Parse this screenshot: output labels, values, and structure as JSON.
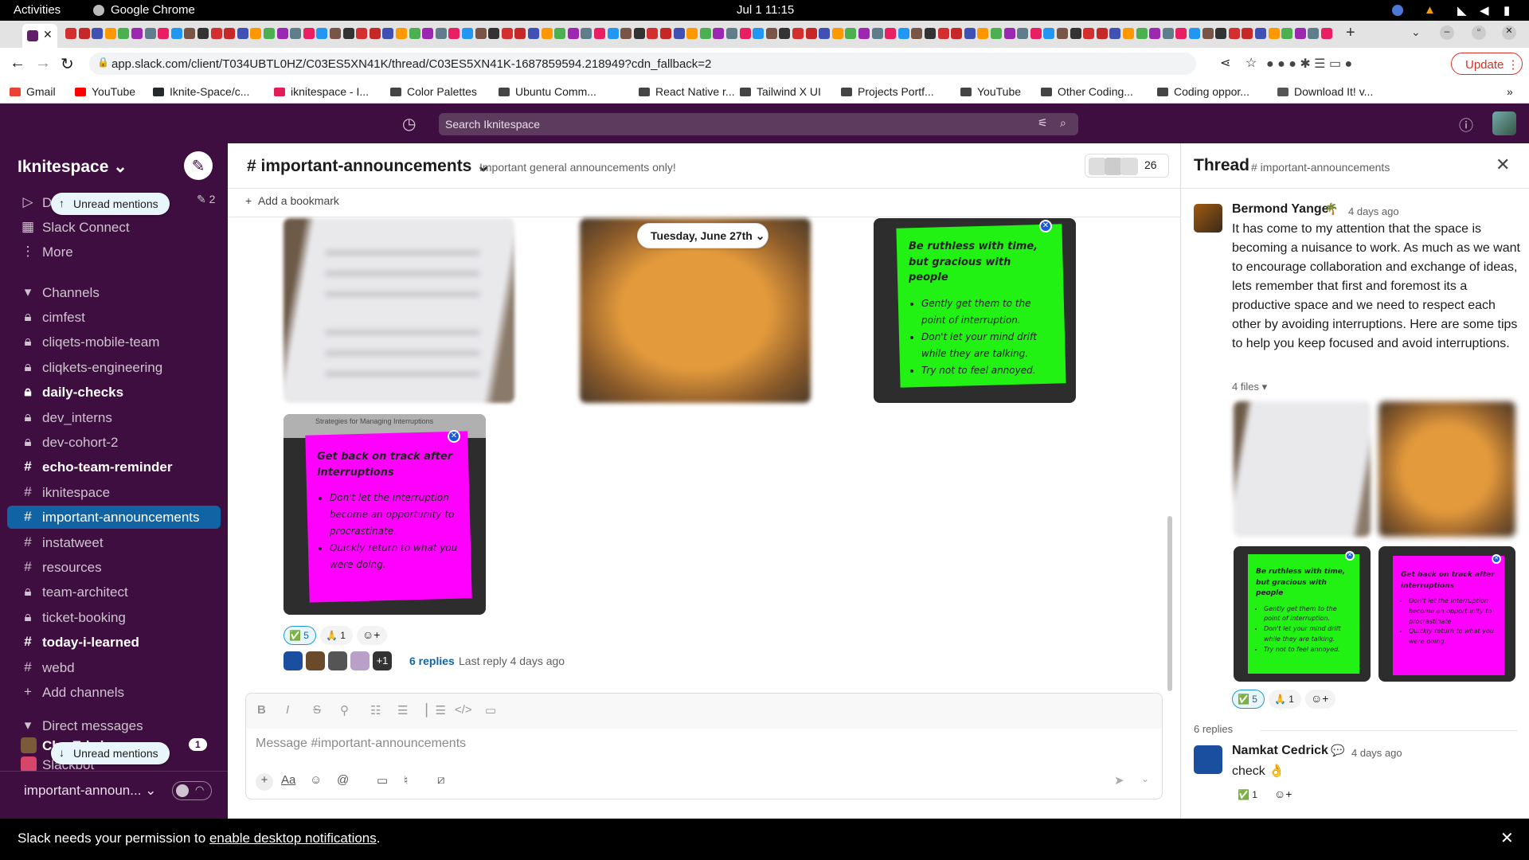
{
  "os": {
    "activities": "Activities",
    "app": "Google Chrome",
    "datetime": "Jul 1  11:15"
  },
  "browser": {
    "url": "app.slack.com/client/T034UBTL0HZ/C03ES5XN41K/thread/C03ES5XN41K-1687859594.218949?cdn_fallback=2",
    "update_label": "Update",
    "bookmarks": [
      "Gmail",
      "YouTube",
      "Iknite-Space/c...",
      "iknitespace - I...",
      "Color Palettes",
      "Ubuntu Comm...",
      "React Native r...",
      "Tailwind X UI",
      "Projects Portf...",
      "YouTube",
      "Other Coding...",
      "Coding oppor...",
      "Download It! v..."
    ]
  },
  "slack": {
    "search_placeholder": "Search Iknitespace",
    "workspace": "Iknitespace",
    "top_items": [
      {
        "label": "D",
        "icon": "send-icon"
      },
      {
        "label": "Slack Connect",
        "icon": "building-icon"
      },
      {
        "label": "More",
        "icon": "more-icon"
      }
    ],
    "drafts_count": "2",
    "unread_pill": "Unread mentions",
    "channels_header": "Channels",
    "channels": [
      {
        "name": "cimfest",
        "icon": "lock",
        "bold": false
      },
      {
        "name": "cliqets-mobile-team",
        "icon": "lock",
        "bold": false
      },
      {
        "name": "cliqkets-engineering",
        "icon": "lock",
        "bold": false
      },
      {
        "name": "daily-checks",
        "icon": "lock",
        "bold": true
      },
      {
        "name": "dev_interns",
        "icon": "lock",
        "bold": false
      },
      {
        "name": "dev-cohort-2",
        "icon": "lock",
        "bold": false
      },
      {
        "name": "echo-team-reminder",
        "icon": "hash",
        "bold": true
      },
      {
        "name": "iknitespace",
        "icon": "hash",
        "bold": false
      },
      {
        "name": "important-announcements",
        "icon": "hash",
        "bold": false,
        "selected": true
      },
      {
        "name": "instatweet",
        "icon": "hash",
        "bold": false
      },
      {
        "name": "resources",
        "icon": "hash",
        "bold": false
      },
      {
        "name": "team-architect",
        "icon": "lock",
        "bold": false
      },
      {
        "name": "ticket-booking",
        "icon": "lock",
        "bold": false
      },
      {
        "name": "today-i-learned",
        "icon": "hash",
        "bold": true
      },
      {
        "name": "webd",
        "icon": "hash",
        "bold": false
      }
    ],
    "add_channels": "Add channels",
    "dm_header": "Direct messages",
    "dms": [
      {
        "name": "Chu Edwin",
        "badge": "1"
      },
      {
        "name": "Slackbot"
      }
    ],
    "bottom_channel": "important-announ...",
    "channel": {
      "name": "# important-announcements",
      "topic": "Important general announcements only!",
      "member_count": "26",
      "add_bookmark": "Add a bookmark",
      "date_pill": "Tuesday, June 27th",
      "note_green": {
        "title": "Be ruthless with time, but gracious with people",
        "bullets": [
          "Gently get them to the point of interruption.",
          "Don't let your mind drift while they are talking.",
          "Try not to feel annoyed."
        ]
      },
      "note_pink": {
        "title": "Get back on track after interruptions",
        "bullets": [
          "Don't let the interruption become an opportunity to procrastinate.",
          "Quickly return to what you were doing."
        ]
      },
      "note_pink_header": "Strategies for Managing Interruptions",
      "reactions": [
        {
          "emoji": "✅",
          "count": "5",
          "mine": true
        },
        {
          "emoji": "🙏",
          "count": "1",
          "mine": false
        }
      ],
      "extra_repliers": "+1",
      "replies_link": "6 replies",
      "last_reply": "Last reply 4 days ago",
      "composer_placeholder": "Message #important-announcements"
    },
    "thread": {
      "title": "Thread",
      "channel": "# important-announcements",
      "author": "Bermond Yange",
      "author_time": "4 days ago",
      "message": "It has come to my attention that the space is becoming a nuisance to work. As much as we want to encourage collaboration and exchange of ideas, lets remember that first and foremost its a productive space and we need to respect each other by avoiding interruptions. Here are some tips to help you keep focused and avoid interruptions.",
      "files_label": "4 files",
      "replies_count": "6 replies",
      "reply_author": "Namkat Cedrick",
      "reply_time": "4 days ago",
      "reply_text": "check 👌",
      "reply_reaction_count": "1"
    }
  },
  "notification": {
    "text": "Slack needs your permission to ",
    "link": "enable desktop notifications",
    "end": "."
  }
}
